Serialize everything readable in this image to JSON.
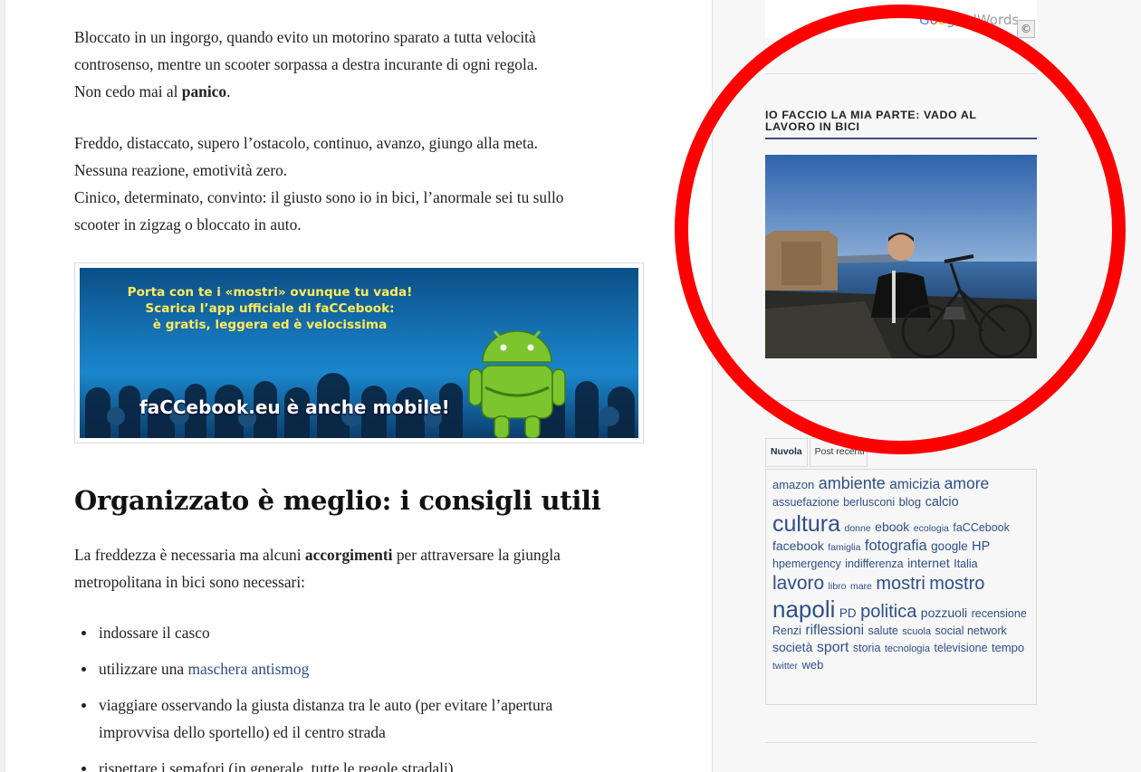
{
  "article": {
    "p1_line1": "Bloccato in un ingorgo, quando evito un motorino sparato a tutta velocità",
    "p1_line2": "controsenso, mentre un scooter sorpassa a destra incurante di ogni regola.",
    "p1_line3_pre": "Non cedo mai al ",
    "p1_line3_bold": "panico",
    "p1_line3_post": ".",
    "p2_line1": "Freddo, distaccato, supero l’ostacolo, continuo, avanzo, giungo alla meta.",
    "p2_line2": "Nessuna reazione, emotività zero.",
    "p2_line3": "Cinico, determinato, convinto: il giusto sono io in bici, l’anormale sei tu sullo",
    "p2_line4": "scooter in zigzag o bloccato in auto.",
    "heading": "Organizzato è meglio: i consigli utili",
    "p3_line1_pre": "La freddezza è necessaria ma alcuni ",
    "p3_line1_bold": "accorgimenti",
    "p3_line1_post": " per attraversare la giungla",
    "p3_line2": "metropolitana in bici sono necessari:",
    "list": {
      "item1": "indossare il casco",
      "item2_pre": "utilizzare una ",
      "item2_link": "maschera antismog",
      "item3_line1": "viaggiare osservando la giusta distanza tra le auto (per evitare l’apertura",
      "item3_line2": "improvvisa dello sportello) ed il centro strada",
      "item4": "rispettare i semafori (in generale, tutte le regole stradali)"
    }
  },
  "banner": {
    "line1": "Porta con te i «mostri» ovunque tu vada!",
    "line2": "Scarica l’app ufficiale di faCCebook:",
    "line3": "è gratis, leggera ed è velocissima",
    "mobile": "faCCebook.eu è anche mobile!"
  },
  "sidebar": {
    "ad": {
      "logo_rest": "AdWords",
      "choice_glyph": "©"
    },
    "widget_title_line1": "IO FACCIO LA MIA PARTE: VADO AL",
    "widget_title_line2": "LAVORO IN BICI",
    "tabs": {
      "tab1": "Nuvola",
      "tab2": "Post recenti"
    },
    "tags": [
      {
        "text": "amazon",
        "size": 13
      },
      {
        "text": "ambiente",
        "size": 18
      },
      {
        "text": "amicizia",
        "size": 15.5
      },
      {
        "text": "amore",
        "size": 17.5
      },
      {
        "text": "assuefazione",
        "size": 12.5
      },
      {
        "text": "berlusconi",
        "size": 12.5
      },
      {
        "text": "blog",
        "size": 13
      },
      {
        "text": "calcio",
        "size": 14.5
      },
      {
        "text": "cultura",
        "size": 25
      },
      {
        "text": "donne",
        "size": 10.5
      },
      {
        "text": "ebook",
        "size": 14
      },
      {
        "text": "ecologia",
        "size": 10.5
      },
      {
        "text": "faCCebook",
        "size": 12.5
      },
      {
        "text": "facebook",
        "size": 14
      },
      {
        "text": "famiglia",
        "size": 10.5
      },
      {
        "text": "fotografia",
        "size": 16.5
      },
      {
        "text": "google",
        "size": 13.5
      },
      {
        "text": "HP",
        "size": 14.5
      },
      {
        "text": "hpemergency",
        "size": 12.5
      },
      {
        "text": "indifferenza",
        "size": 12.5
      },
      {
        "text": "internet",
        "size": 14
      },
      {
        "text": "Italia",
        "size": 12.5
      },
      {
        "text": "lavoro",
        "size": 21
      },
      {
        "text": "libro",
        "size": 10.5
      },
      {
        "text": "mare",
        "size": 10.5
      },
      {
        "text": "mostri",
        "size": 20
      },
      {
        "text": "mostro",
        "size": 20
      },
      {
        "text": "napoli",
        "size": 26
      },
      {
        "text": "PD",
        "size": 13.5
      },
      {
        "text": "politica",
        "size": 20
      },
      {
        "text": "pozzuoli",
        "size": 14
      },
      {
        "text": "recensione",
        "size": 12.5
      },
      {
        "text": "Renzi",
        "size": 12.5
      },
      {
        "text": "riflessioni",
        "size": 15.5
      },
      {
        "text": "salute",
        "size": 12.5
      },
      {
        "text": "scuola",
        "size": 11
      },
      {
        "text": "social network",
        "size": 12.5
      },
      {
        "text": "società",
        "size": 14
      },
      {
        "text": "sport",
        "size": 16
      },
      {
        "text": "storia",
        "size": 12.5
      },
      {
        "text": "tecnologia",
        "size": 11
      },
      {
        "text": "televisione",
        "size": 12.5
      },
      {
        "text": "tempo",
        "size": 13
      },
      {
        "text": "twitter",
        "size": 10.5
      },
      {
        "text": "web",
        "size": 13
      }
    ]
  },
  "colors": {
    "link": "#2e4f8a",
    "highlight_ring": "#ff0000",
    "title_rule": "#3e4f79"
  }
}
